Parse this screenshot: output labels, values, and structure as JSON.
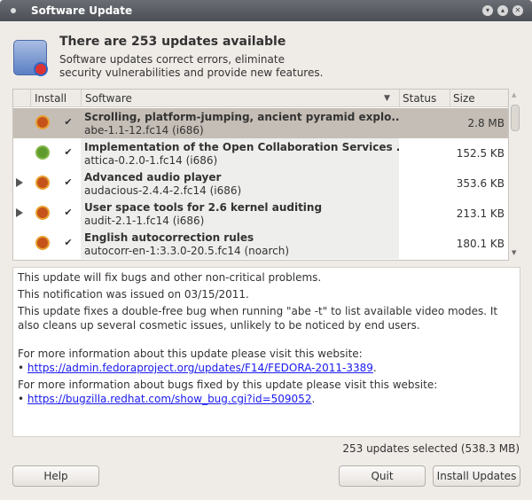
{
  "window": {
    "title": "Software Update"
  },
  "header": {
    "title": "There are 253 updates available",
    "subtitle_line1": "Software updates correct errors, eliminate",
    "subtitle_line2": "security vulnerabilities and provide new features."
  },
  "table": {
    "columns": {
      "install": "Install",
      "software": "Software",
      "status": "Status",
      "size": "Size"
    },
    "rows": [
      {
        "name": "Scrolling, platform-jumping, ancient pyramid explo...",
        "package": "abe-1.1-12.fc14 (i686)",
        "size": "2.8 MB",
        "checked": true,
        "expander": false,
        "icon": "bugfix-icon",
        "selected": true
      },
      {
        "name": "Implementation of the Open Collaboration Services ...",
        "package": "attica-0.2.0-1.fc14 (i686)",
        "size": "152.5 KB",
        "checked": true,
        "expander": false,
        "icon": "enhancement-icon",
        "selected": false
      },
      {
        "name": "Advanced audio player",
        "package": "audacious-2.4.4-2.fc14 (i686)",
        "size": "353.6 KB",
        "checked": true,
        "expander": true,
        "icon": "bugfix-icon",
        "selected": false
      },
      {
        "name": "User space tools for 2.6 kernel auditing",
        "package": "audit-2.1-1.fc14 (i686)",
        "size": "213.1 KB",
        "checked": true,
        "expander": true,
        "icon": "bugfix-icon",
        "selected": false
      },
      {
        "name": "English autocorrection rules",
        "package": "autocorr-en-1:3.3.0-20.5.fc14 (noarch)",
        "size": "180.1 KB",
        "checked": true,
        "expander": false,
        "icon": "bugfix-icon",
        "selected": false
      }
    ]
  },
  "detail": {
    "line1": "This update will fix bugs and other non-critical problems.",
    "line2": "This notification was issued on 03/15/2011.",
    "line3": "This update fixes a double-free bug when running \"abe -t\" to list available video modes.  It also cleans up several cosmetic issues, unlikely to be noticed by end users.",
    "info1": "For more information about this update please visit this website:",
    "link1": "https://admin.fedoraproject.org/updates/F14/FEDORA-2011-3389",
    "info2": "For more information about bugs fixed by this update please visit this website:",
    "link2": "https://bugzilla.redhat.com/show_bug.cgi?id=509052"
  },
  "status": "253 updates selected (538.3 MB)",
  "buttons": {
    "help": "Help",
    "quit": "Quit",
    "install": "Install Updates"
  }
}
